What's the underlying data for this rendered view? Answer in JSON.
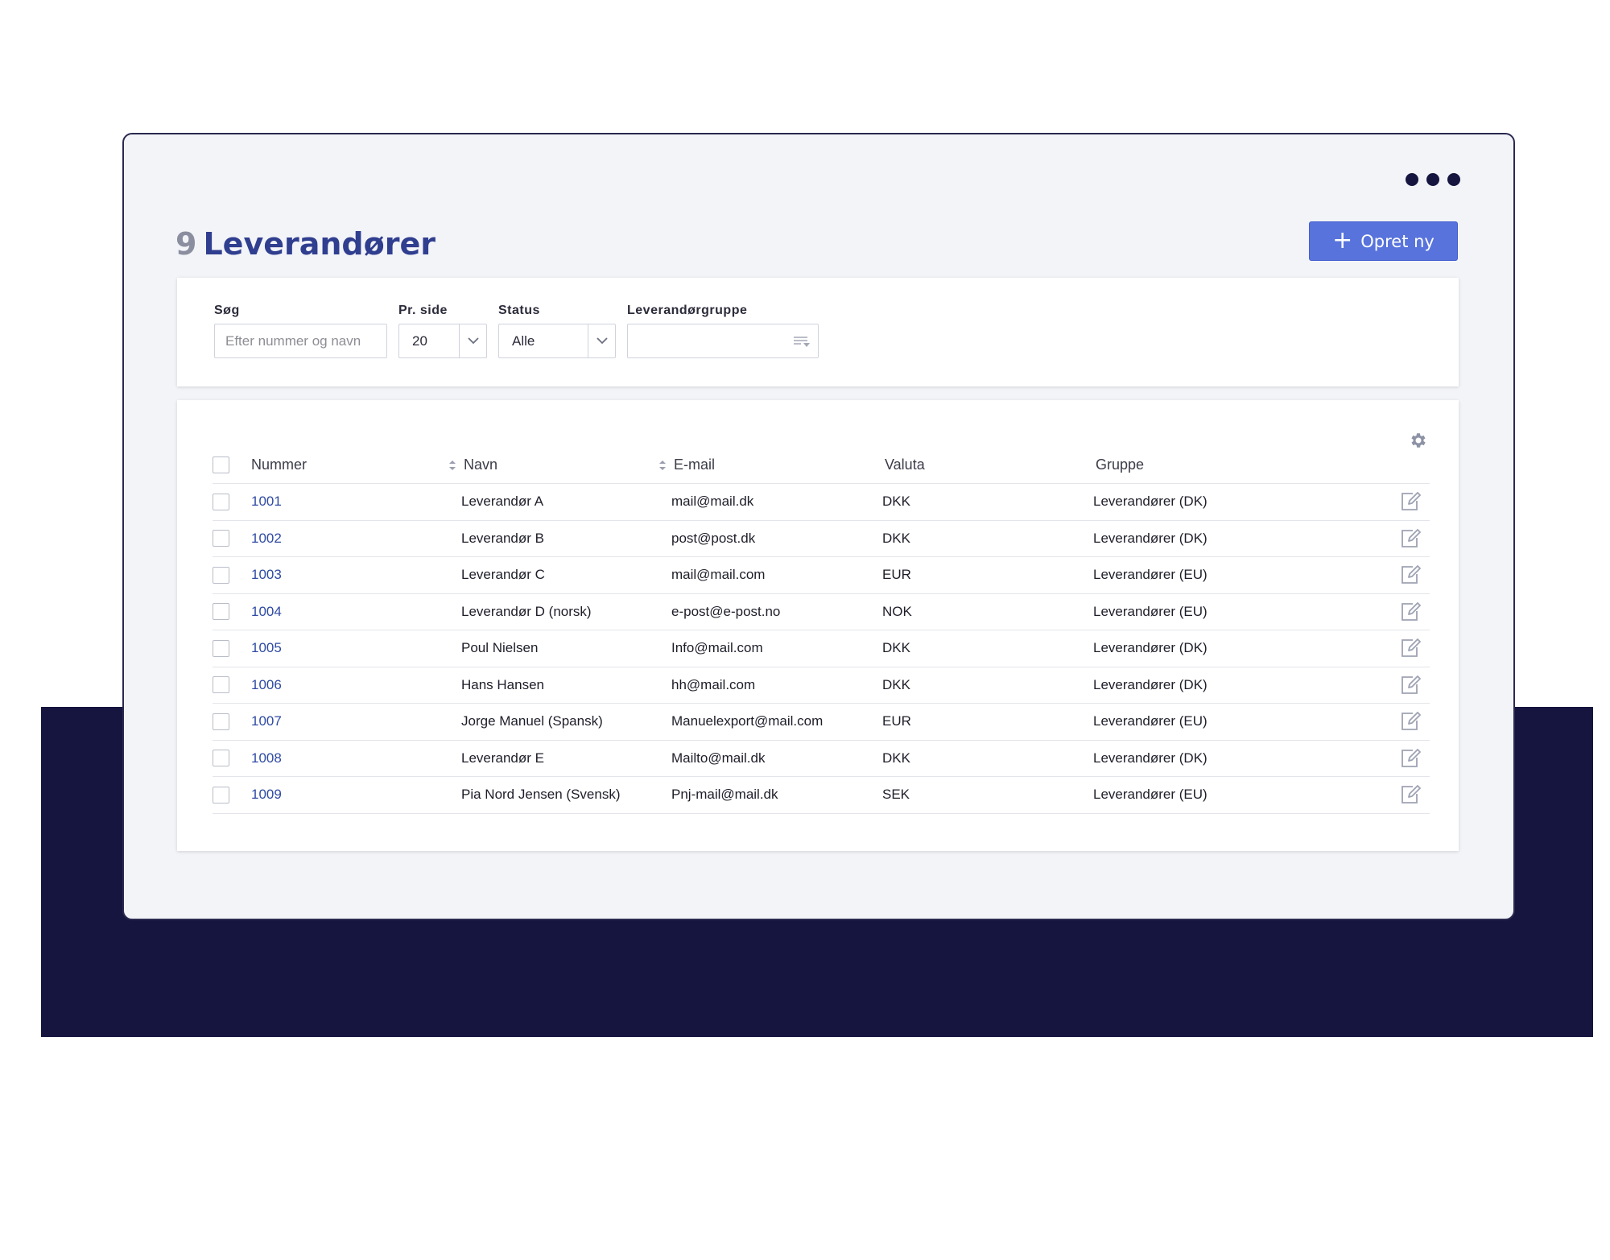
{
  "page": {
    "count": "9",
    "title": "Leverandører",
    "create_label": "Opret ny"
  },
  "filters": {
    "search_label": "Søg",
    "search_placeholder": "Efter nummer og navn",
    "per_page_label": "Pr. side",
    "per_page_value": "20",
    "status_label": "Status",
    "status_value": "Alle",
    "group_label": "Leverandørgruppe",
    "group_value": ""
  },
  "table": {
    "columns": [
      "Nummer",
      "Navn",
      "E-mail",
      "Valuta",
      "Gruppe"
    ],
    "rows": [
      {
        "number": "1001",
        "name": "Leverandør A",
        "email": "mail@mail.dk",
        "currency": "DKK",
        "group": "Leverandører (DK)"
      },
      {
        "number": "1002",
        "name": "Leverandør B",
        "email": "post@post.dk",
        "currency": "DKK",
        "group": "Leverandører (DK)"
      },
      {
        "number": "1003",
        "name": "Leverandør C",
        "email": "mail@mail.com",
        "currency": "EUR",
        "group": "Leverandører (EU)"
      },
      {
        "number": "1004",
        "name": "Leverandør D (norsk)",
        "email": "e-post@e-post.no",
        "currency": "NOK",
        "group": "Leverandører (EU)"
      },
      {
        "number": "1005",
        "name": "Poul Nielsen",
        "email": "Info@mail.com",
        "currency": "DKK",
        "group": "Leverandører (DK)"
      },
      {
        "number": "1006",
        "name": "Hans Hansen",
        "email": "hh@mail.com",
        "currency": "DKK",
        "group": "Leverandører (DK)"
      },
      {
        "number": "1007",
        "name": "Jorge Manuel (Spansk)",
        "email": "Manuelexport@mail.com",
        "currency": "EUR",
        "group": "Leverandører (EU)"
      },
      {
        "number": "1008",
        "name": "Leverandør E",
        "email": "Mailto@mail.dk",
        "currency": "DKK",
        "group": "Leverandører (DK)"
      },
      {
        "number": "1009",
        "name": "Pia Nord Jensen (Svensk)",
        "email": "Pnj-mail@mail.dk",
        "currency": "SEK",
        "group": "Leverandører (EU)"
      }
    ]
  },
  "colors": {
    "accent": "#5873dc",
    "link": "#2f4aa3",
    "dark_band": "#16153f",
    "window_bg": "#f3f4f8"
  },
  "icons": [
    "more-dots-icon",
    "plus-icon",
    "chevron-down-icon",
    "filter-list-icon",
    "gear-icon",
    "sort-icon",
    "edit-icon"
  ]
}
